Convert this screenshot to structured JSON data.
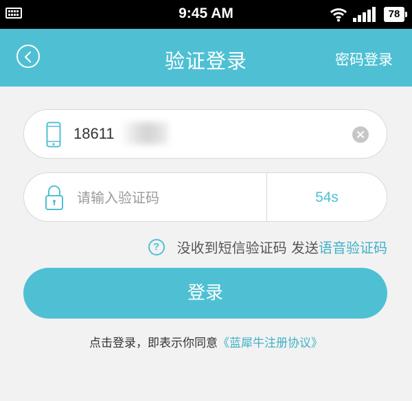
{
  "status_bar": {
    "time": "9:45 AM",
    "battery": "78",
    "icons": [
      "keyboard-icon",
      "wifi-icon",
      "signal-icon",
      "battery-icon"
    ]
  },
  "nav": {
    "back_icon": "back-arrow-icon",
    "title": "验证登录",
    "password_login": "密码登录"
  },
  "phone_field": {
    "icon": "phone-icon",
    "value": "18611",
    "clear_icon": "clear-icon"
  },
  "code_field": {
    "icon": "lock-icon",
    "placeholder": "请输入验证码",
    "countdown": "54s"
  },
  "help": {
    "icon": "question-icon",
    "icon_glyph": "?",
    "text": "没收到短信验证码 发送",
    "voice_link": "语音验证码"
  },
  "login_button": "登录",
  "terms": {
    "text": "点击登录，即表示你同意",
    "link": "《蓝犀牛注册协议》"
  },
  "colors": {
    "accent": "#4fc0d3",
    "status_bar": "#000000",
    "background": "#f2f2f2"
  }
}
